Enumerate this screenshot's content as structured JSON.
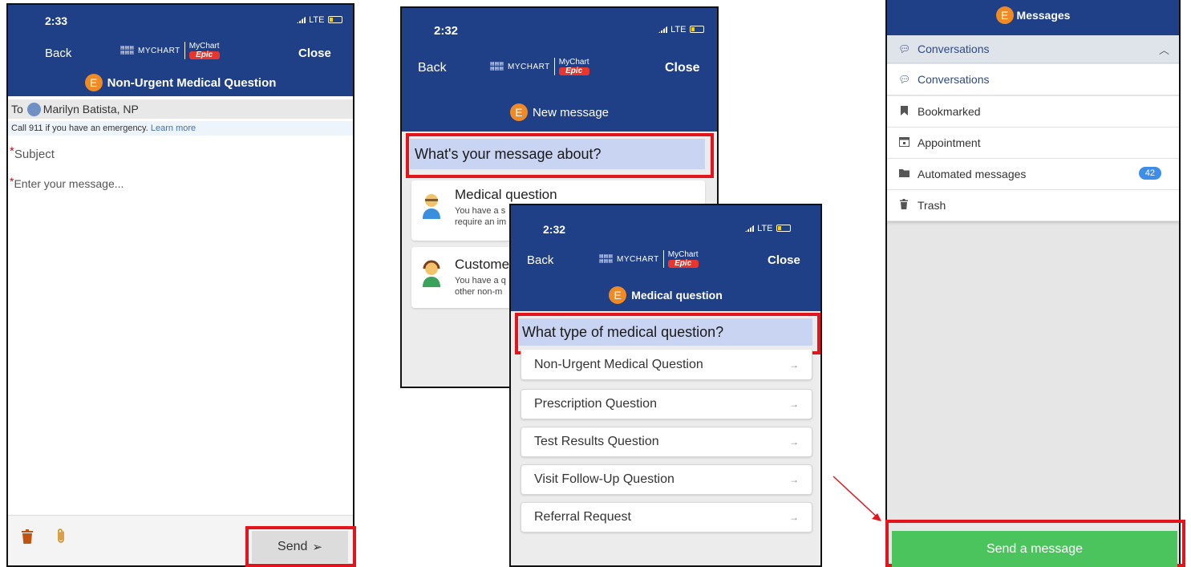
{
  "panel1": {
    "time": "2:33",
    "signal": "LTE",
    "back": "Back",
    "mychart": "MYCHART",
    "brand": "MyChart",
    "epic": "Epic",
    "close": "Close",
    "avatar_letter": "E",
    "title": "Non-Urgent Medical Question",
    "to_label": "To",
    "recipient": "Marilyn Batista, NP",
    "emergency_text": "Call 911 if you have an emergency.",
    "learn_more": "Learn more",
    "subject_placeholder": "Subject",
    "message_placeholder": "Enter your message...",
    "required_mark": "*",
    "send_label": "Send"
  },
  "panel2": {
    "time": "2:32",
    "signal": "LTE",
    "back": "Back",
    "mychart": "MYCHART",
    "brand": "MyChart",
    "epic": "Epic",
    "close": "Close",
    "avatar_letter": "E",
    "title": "New message",
    "question": "What's your message about?",
    "options": [
      {
        "title": "Medical question",
        "desc1": "You have a s",
        "desc2": "require an im"
      },
      {
        "title": "Custome",
        "desc1": "You have a q",
        "desc2": "other non-m"
      }
    ]
  },
  "panel3": {
    "time": "2:32",
    "signal": "LTE",
    "back": "Back",
    "mychart": "MYCHART",
    "brand": "MyChart",
    "epic": "Epic",
    "close": "Close",
    "avatar_letter": "E",
    "title": "Medical question",
    "question": "What type of medical question?",
    "items": [
      {
        "label": "Non-Urgent Medical Question"
      },
      {
        "label": "Prescription Question"
      },
      {
        "label": "Test Results Question"
      },
      {
        "label": "Visit Follow-Up Question"
      },
      {
        "label": "Referral Request"
      }
    ]
  },
  "panel4": {
    "avatar_letter": "E",
    "title": "Messages",
    "section": "Conversations",
    "folders": [
      {
        "label": "Conversations",
        "icon": "chat-bubble-icon"
      },
      {
        "label": "Bookmarked",
        "icon": "bookmark-icon"
      },
      {
        "label": "Appointment",
        "icon": "calendar-icon"
      },
      {
        "label": "Automated messages",
        "icon": "folder-icon",
        "badge": "42"
      },
      {
        "label": "Trash",
        "icon": "trash-icon"
      }
    ],
    "send_button": "Send a message"
  },
  "colors": {
    "header": "#1f3f87",
    "highlight_border": "#e3141b",
    "avatar": "#f08a24",
    "send_green": "#4cc45e",
    "badge_blue": "#3d8ee8"
  }
}
